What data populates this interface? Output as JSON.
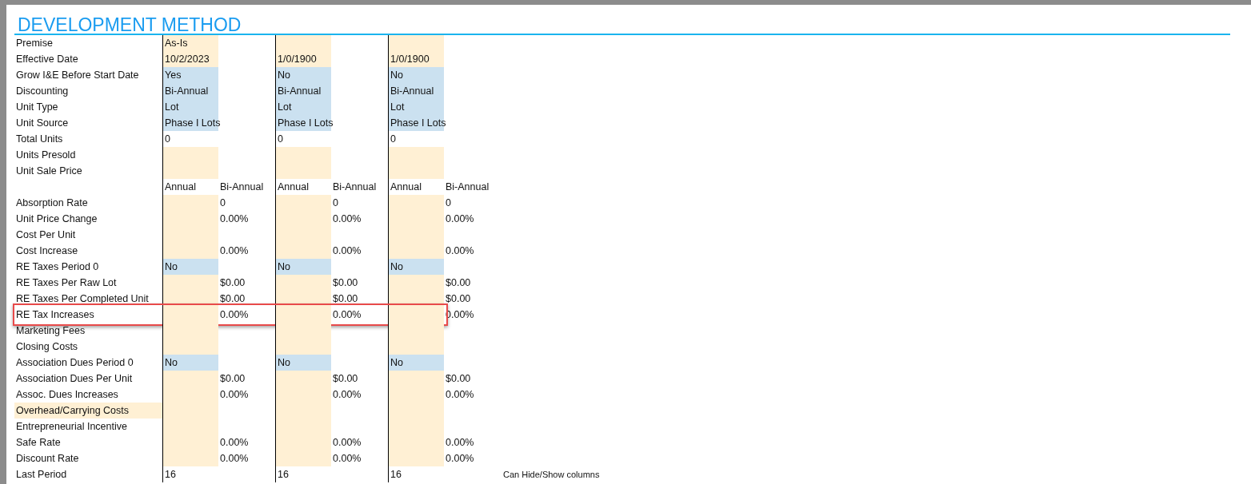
{
  "title": "DEVELOPMENT METHOD",
  "rows": [
    {
      "label": "Premise",
      "cells": [
        {
          "text": "As-Is",
          "kind": "input"
        },
        {},
        {
          "kind": "input"
        },
        {},
        {
          "kind": "input"
        },
        {}
      ]
    },
    {
      "label": "Effective Date",
      "cells": [
        {
          "text": "10/2/2023",
          "kind": "input"
        },
        {},
        {
          "text": "1/0/1900",
          "kind": "input"
        },
        {},
        {
          "text": "1/0/1900",
          "kind": "input"
        },
        {}
      ]
    },
    {
      "label": "Grow I&E Before Start Date",
      "cells": [
        {
          "text": "Yes",
          "kind": "choice"
        },
        {},
        {
          "text": "No",
          "kind": "choice"
        },
        {},
        {
          "text": "No",
          "kind": "choice"
        },
        {}
      ]
    },
    {
      "label": "Discounting",
      "cells": [
        {
          "text": "Bi-Annual",
          "kind": "choice"
        },
        {},
        {
          "text": "Bi-Annual",
          "kind": "choice"
        },
        {},
        {
          "text": "Bi-Annual",
          "kind": "choice"
        },
        {}
      ]
    },
    {
      "label": "Unit Type",
      "cells": [
        {
          "text": "Lot",
          "kind": "choice"
        },
        {},
        {
          "text": "Lot",
          "kind": "choice"
        },
        {},
        {
          "text": "Lot",
          "kind": "choice"
        },
        {}
      ]
    },
    {
      "label": "Unit Source",
      "cells": [
        {
          "text": "Phase I Lots",
          "kind": "choice"
        },
        {},
        {
          "text": "Phase I Lots",
          "kind": "choice"
        },
        {},
        {
          "text": "Phase I Lots",
          "kind": "choice"
        },
        {}
      ]
    },
    {
      "label": "Total Units",
      "cells": [
        {
          "text": "0"
        },
        {},
        {
          "text": "0"
        },
        {},
        {
          "text": "0"
        },
        {}
      ]
    },
    {
      "label": "Units Presold",
      "cells": [
        {
          "kind": "input"
        },
        {},
        {
          "kind": "input"
        },
        {},
        {
          "kind": "input"
        },
        {}
      ]
    },
    {
      "label": "Unit Sale Price",
      "cells": [
        {
          "kind": "input"
        },
        {},
        {
          "kind": "input"
        },
        {},
        {
          "kind": "input"
        },
        {}
      ]
    },
    {
      "cells": [
        {
          "text": "Annual"
        },
        {
          "text": "Bi-Annual"
        },
        {
          "text": "Annual"
        },
        {
          "text": "Bi-Annual"
        },
        {
          "text": "Annual"
        },
        {
          "text": "Bi-Annual"
        }
      ]
    },
    {
      "label": "Absorption Rate",
      "cells": [
        {
          "kind": "input"
        },
        {
          "text": "0"
        },
        {
          "kind": "input"
        },
        {
          "text": "0"
        },
        {
          "kind": "input"
        },
        {
          "text": "0"
        }
      ]
    },
    {
      "label": "Unit Price Change",
      "cells": [
        {
          "kind": "input"
        },
        {
          "text": "0.00%"
        },
        {
          "kind": "input"
        },
        {
          "text": "0.00%"
        },
        {
          "kind": "input"
        },
        {
          "text": "0.00%"
        }
      ]
    },
    {
      "label": "Cost Per Unit",
      "cells": [
        {
          "kind": "input"
        },
        {},
        {
          "kind": "input"
        },
        {},
        {
          "kind": "input"
        },
        {}
      ]
    },
    {
      "label": "Cost Increase",
      "cells": [
        {
          "kind": "input"
        },
        {
          "text": "0.00%"
        },
        {
          "kind": "input"
        },
        {
          "text": "0.00%"
        },
        {
          "kind": "input"
        },
        {
          "text": "0.00%"
        }
      ]
    },
    {
      "label": "RE Taxes Period 0",
      "cells": [
        {
          "text": "No",
          "kind": "choice"
        },
        {},
        {
          "text": "No",
          "kind": "choice"
        },
        {},
        {
          "text": "No",
          "kind": "choice"
        },
        {}
      ]
    },
    {
      "label": "RE Taxes Per Raw Lot",
      "cells": [
        {
          "kind": "input"
        },
        {
          "text": "$0.00"
        },
        {
          "kind": "input"
        },
        {
          "text": "$0.00"
        },
        {
          "kind": "input"
        },
        {
          "text": "$0.00"
        }
      ]
    },
    {
      "label": "RE Taxes Per Completed Unit",
      "cells": [
        {
          "kind": "input"
        },
        {
          "text": "$0.00"
        },
        {
          "kind": "input"
        },
        {
          "text": "$0.00"
        },
        {
          "kind": "input"
        },
        {
          "text": "$0.00"
        }
      ]
    },
    {
      "label": "RE Tax Increases",
      "highlighted": true,
      "cells": [
        {
          "kind": "input"
        },
        {
          "text": "0.00%"
        },
        {
          "kind": "input"
        },
        {
          "text": "0.00%"
        },
        {
          "kind": "input"
        },
        {
          "text": "0.00%"
        }
      ]
    },
    {
      "label": "Marketing Fees",
      "cells": [
        {
          "kind": "input"
        },
        {},
        {
          "kind": "input"
        },
        {},
        {
          "kind": "input"
        },
        {}
      ]
    },
    {
      "label": "Closing Costs",
      "cells": [
        {
          "kind": "input"
        },
        {},
        {
          "kind": "input"
        },
        {},
        {
          "kind": "input"
        },
        {}
      ]
    },
    {
      "label": "Association Dues Period 0",
      "cells": [
        {
          "text": "No",
          "kind": "choice"
        },
        {},
        {
          "text": "No",
          "kind": "choice"
        },
        {},
        {
          "text": "No",
          "kind": "choice"
        },
        {}
      ]
    },
    {
      "label": "Association Dues Per Unit",
      "cells": [
        {
          "kind": "input"
        },
        {
          "text": "$0.00"
        },
        {
          "kind": "input"
        },
        {
          "text": "$0.00"
        },
        {
          "kind": "input"
        },
        {
          "text": "$0.00"
        }
      ]
    },
    {
      "label": "Assoc. Dues Increases",
      "cells": [
        {
          "kind": "input"
        },
        {
          "text": "0.00%"
        },
        {
          "kind": "input"
        },
        {
          "text": "0.00%"
        },
        {
          "kind": "input"
        },
        {
          "text": "0.00%"
        }
      ]
    },
    {
      "label": "Overhead/Carrying Costs",
      "label_highlighted": true,
      "cells": [
        {
          "kind": "input"
        },
        {},
        {
          "kind": "input"
        },
        {},
        {
          "kind": "input"
        },
        {}
      ]
    },
    {
      "label": "Entrepreneurial Incentive",
      "cells": [
        {
          "kind": "input"
        },
        {},
        {
          "kind": "input"
        },
        {},
        {
          "kind": "input"
        },
        {}
      ]
    },
    {
      "label": "Safe Rate",
      "cells": [
        {
          "kind": "input"
        },
        {
          "text": "0.00%"
        },
        {
          "kind": "input"
        },
        {
          "text": "0.00%"
        },
        {
          "kind": "input"
        },
        {
          "text": "0.00%"
        }
      ]
    },
    {
      "label": "Discount Rate",
      "cells": [
        {
          "kind": "input"
        },
        {
          "text": "0.00%"
        },
        {
          "kind": "input"
        },
        {
          "text": "0.00%"
        },
        {
          "kind": "input"
        },
        {
          "text": "0.00%"
        }
      ]
    },
    {
      "label": "Last Period",
      "cells": [
        {
          "text": "16"
        },
        {},
        {
          "text": "16"
        },
        {},
        {
          "text": "16"
        },
        {}
      ],
      "note": "Can Hide/Show columns"
    }
  ]
}
